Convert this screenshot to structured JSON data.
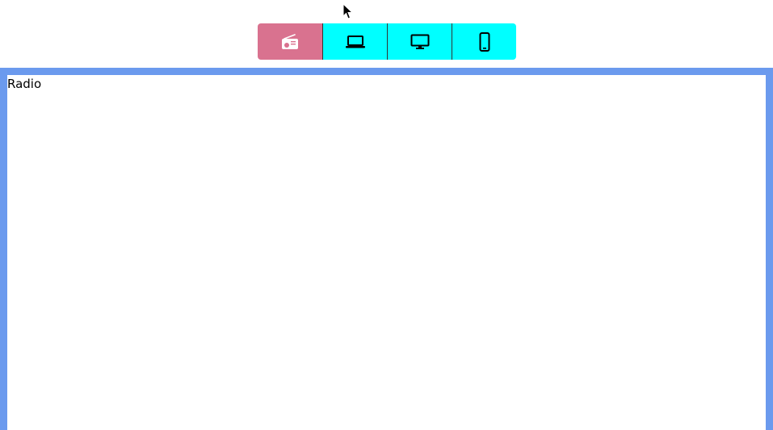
{
  "tabs": [
    {
      "icon": "radio-icon",
      "active": true
    },
    {
      "icon": "laptop-icon",
      "active": false
    },
    {
      "icon": "desktop-monitor-icon",
      "active": false
    },
    {
      "icon": "mobile-phone-icon",
      "active": false
    }
  ],
  "colors": {
    "tab_active_bg": "#d9728f",
    "tab_inactive_bg": "#00ffff",
    "panel_border": "#6b9aee",
    "active_icon": "#ffffff",
    "inactive_icon": "#000000"
  },
  "panel": {
    "content": "Radio"
  }
}
